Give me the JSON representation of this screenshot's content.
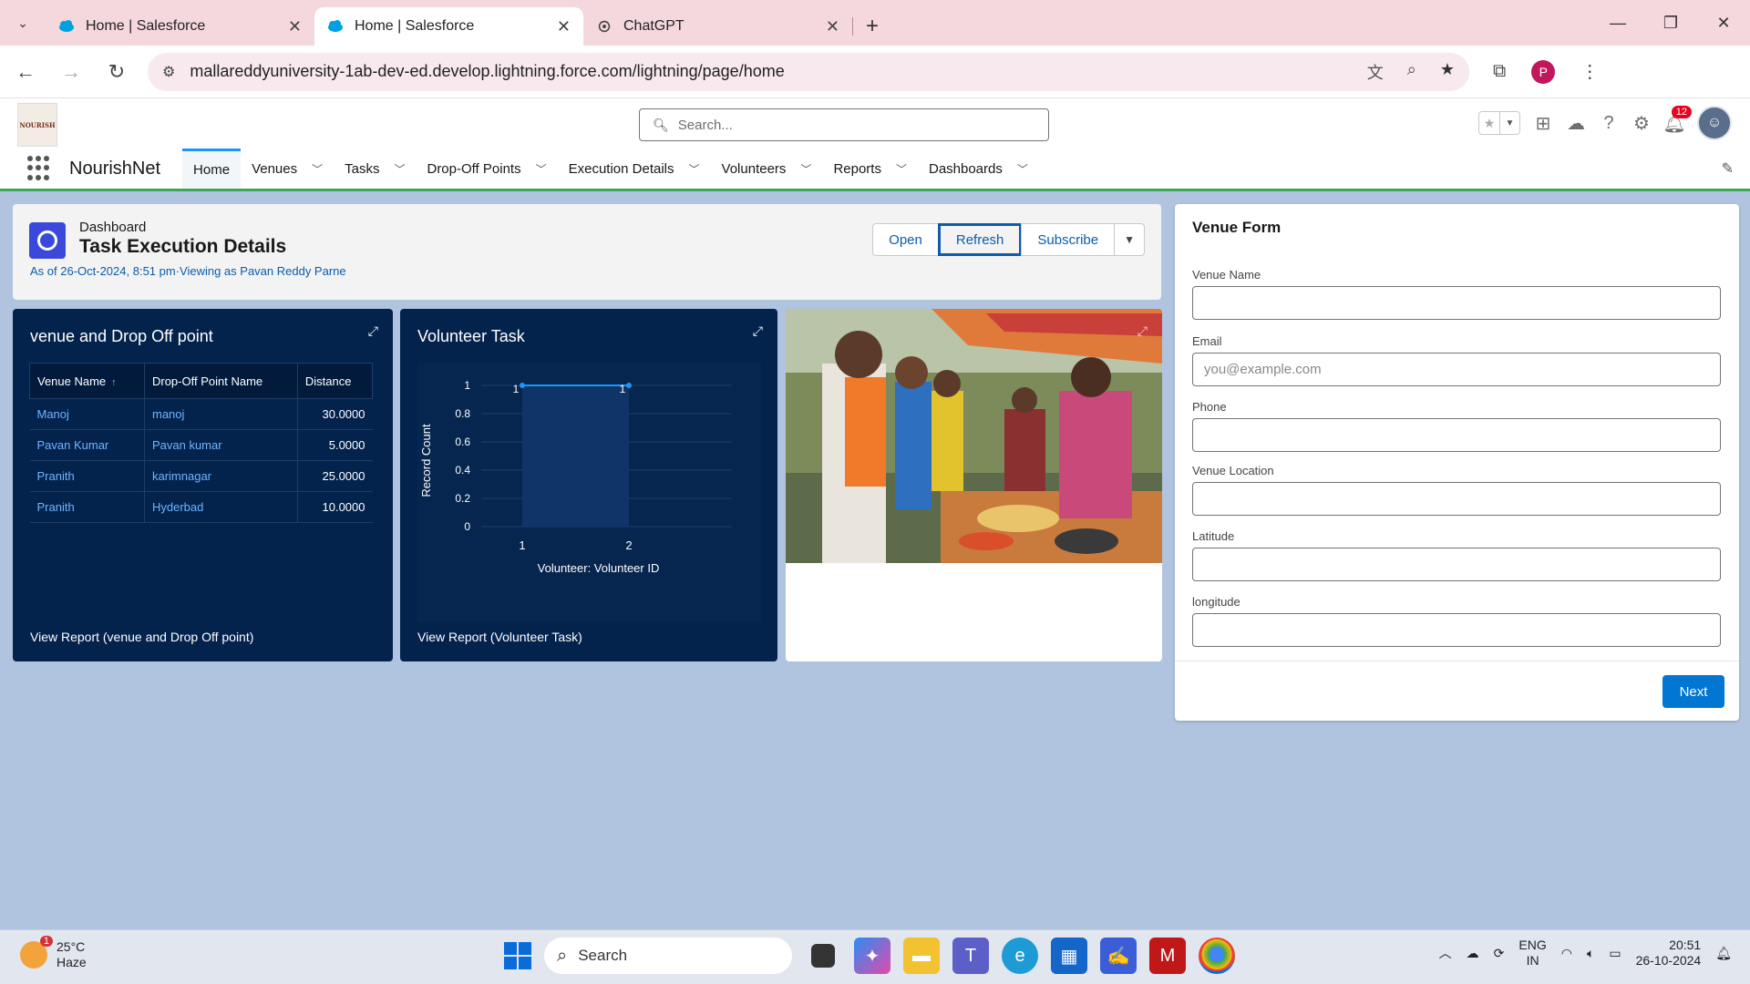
{
  "browser": {
    "tabs": [
      {
        "title": "Home | Salesforce",
        "active": false
      },
      {
        "title": "Home | Salesforce",
        "active": true
      },
      {
        "title": "ChatGPT",
        "active": false
      }
    ],
    "url": "mallareddyuniversity-1ab-dev-ed.develop.lightning.force.com/lightning/page/home",
    "profile_initial": "P"
  },
  "sf": {
    "logo_text": "NOURISH",
    "search_placeholder": "Search...",
    "notification_count": "12",
    "app_name": "NourishNet",
    "nav": [
      {
        "label": "Home",
        "has_menu": false
      },
      {
        "label": "Venues",
        "has_menu": true
      },
      {
        "label": "Tasks",
        "has_menu": true
      },
      {
        "label": "Drop-Off Points",
        "has_menu": true
      },
      {
        "label": "Execution Details",
        "has_menu": true
      },
      {
        "label": "Volunteers",
        "has_menu": true
      },
      {
        "label": "Reports",
        "has_menu": true
      },
      {
        "label": "Dashboards",
        "has_menu": true
      }
    ]
  },
  "dashboard": {
    "eyebrow": "Dashboard",
    "title": "Task Execution Details",
    "meta": "As of 26-Oct-2024, 8:51 pm·Viewing as Pavan Reddy Parne",
    "buttons": {
      "open": "Open",
      "refresh": "Refresh",
      "subscribe": "Subscribe"
    }
  },
  "widget_table": {
    "title": "venue and Drop Off point",
    "columns": [
      "Venue Name",
      "Drop-Off Point Name",
      "Distance"
    ],
    "rows": [
      [
        "Manoj",
        "manoj",
        "30.0000"
      ],
      [
        "Pavan Kumar",
        "Pavan kumar",
        "5.0000"
      ],
      [
        "Pranith",
        "karimnagar",
        "25.0000"
      ],
      [
        "Pranith",
        "Hyderbad",
        "10.0000"
      ]
    ],
    "footer": "View Report (venue and Drop Off point)"
  },
  "widget_chart": {
    "title": "Volunteer Task",
    "footer": "View Report (Volunteer Task)"
  },
  "chart_data": {
    "type": "area",
    "categories": [
      "1",
      "2"
    ],
    "series": [
      {
        "values": [
          1,
          1
        ]
      }
    ],
    "data_labels": [
      "1",
      "1"
    ],
    "xlabel": "Volunteer: Volunteer ID",
    "ylabel": "Record Count",
    "ylim": [
      0,
      1
    ],
    "yticks": [
      "0",
      "0.2",
      "0.4",
      "0.6",
      "0.8",
      "1"
    ],
    "line_color": "#1b96ff",
    "fill_color": "#0f3568",
    "grid": true
  },
  "venue_form": {
    "title": "Venue Form",
    "fields": [
      {
        "label": "Venue Name",
        "value": "",
        "placeholder": ""
      },
      {
        "label": "Email",
        "value": "",
        "placeholder": "you@example.com"
      },
      {
        "label": "Phone",
        "value": "",
        "placeholder": ""
      },
      {
        "label": "Venue Location",
        "value": "",
        "placeholder": ""
      },
      {
        "label": "Latitude",
        "value": "",
        "placeholder": ""
      },
      {
        "label": "longitude",
        "value": "",
        "placeholder": ""
      }
    ],
    "next_label": "Next"
  },
  "taskbar": {
    "weather_badge": "1",
    "temperature": "25°C",
    "condition": "Haze",
    "search_label": "Search",
    "lang_line1": "ENG",
    "lang_line2": "IN",
    "time": "20:51",
    "date": "26-10-2024"
  },
  "colors": {
    "brand_blue": "#0176d3",
    "widget_bg": "#03234d",
    "nav_active_border": "#1b96ff",
    "header_underline": "#3ba755",
    "notification_red": "#ea001e"
  }
}
